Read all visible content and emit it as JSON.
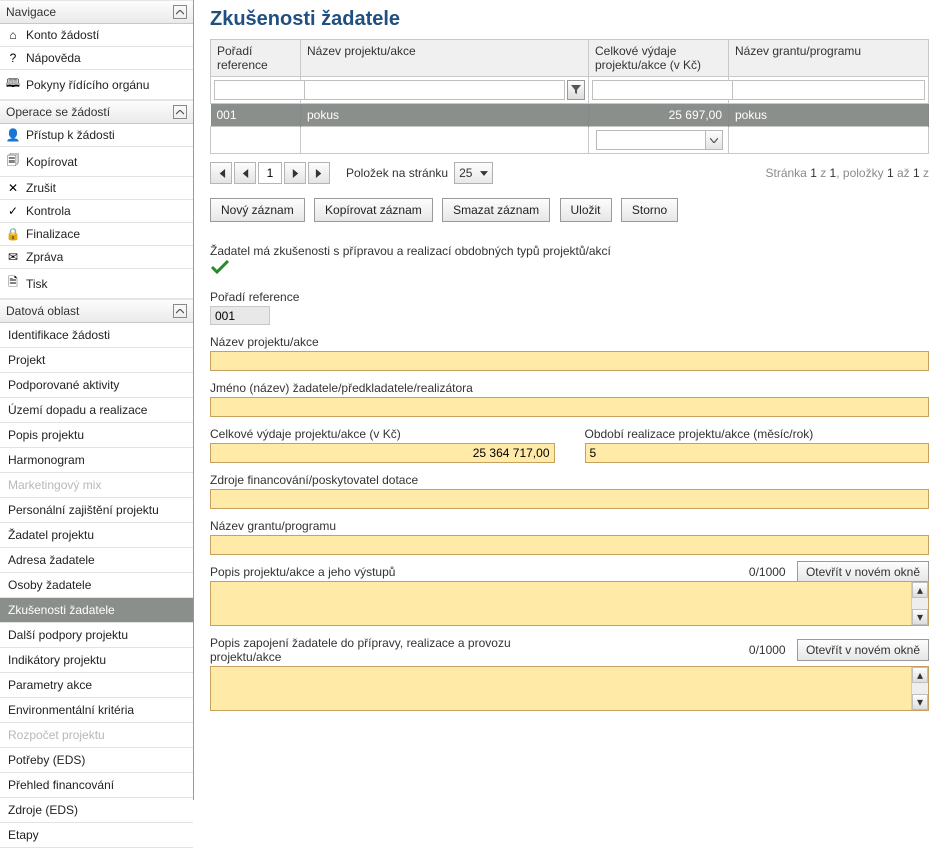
{
  "sidebar": {
    "nav_header": "Navigace",
    "nav_items": [
      {
        "icon": "⌂",
        "label": "Konto žádostí",
        "name": "nav-konto",
        "interactable": true
      },
      {
        "icon": "?",
        "label": "Nápověda",
        "name": "nav-help",
        "interactable": true
      },
      {
        "icon": "🕮",
        "label": "Pokyny řídícího orgánu",
        "name": "nav-pokyny",
        "interactable": true
      }
    ],
    "ops_header": "Operace se žádostí",
    "ops_items": [
      {
        "icon": "👤",
        "label": "Přístup k žádosti",
        "name": "op-access"
      },
      {
        "icon": "🗐",
        "label": "Kopírovat",
        "name": "op-copy"
      },
      {
        "icon": "✕",
        "label": "Zrušit",
        "name": "op-cancel"
      },
      {
        "icon": "✓",
        "label": "Kontrola",
        "name": "op-check"
      },
      {
        "icon": "🔒",
        "label": "Finalizace",
        "name": "op-finalize"
      },
      {
        "icon": "✉",
        "label": "Zpráva",
        "name": "op-message"
      },
      {
        "icon": "🗎",
        "label": "Tisk",
        "name": "op-print"
      }
    ],
    "data_header": "Datová oblast",
    "data_items": [
      {
        "label": "Identifikace žádosti",
        "name": "data-ident",
        "state": ""
      },
      {
        "label": "Projekt",
        "name": "data-projekt",
        "state": ""
      },
      {
        "label": "Podporované aktivity",
        "name": "data-aktivity",
        "state": ""
      },
      {
        "label": "Území dopadu a realizace",
        "name": "data-uzemi",
        "state": ""
      },
      {
        "label": "Popis projektu",
        "name": "data-popis",
        "state": ""
      },
      {
        "label": "Harmonogram",
        "name": "data-harmon",
        "state": ""
      },
      {
        "label": "Marketingový mix",
        "name": "data-marketing",
        "state": "disabled"
      },
      {
        "label": "Personální zajištění projektu",
        "name": "data-personal",
        "state": ""
      },
      {
        "label": "Žadatel projektu",
        "name": "data-zadatel",
        "state": ""
      },
      {
        "label": "Adresa žadatele",
        "name": "data-adresa",
        "state": ""
      },
      {
        "label": "Osoby žadatele",
        "name": "data-osoby",
        "state": ""
      },
      {
        "label": "Zkušenosti žadatele",
        "name": "data-zkusenosti",
        "state": "active"
      },
      {
        "label": "Další podpory projektu",
        "name": "data-podpory",
        "state": ""
      },
      {
        "label": "Indikátory projektu",
        "name": "data-indik",
        "state": ""
      },
      {
        "label": "Parametry akce",
        "name": "data-param",
        "state": ""
      },
      {
        "label": "Environmentální kritéria",
        "name": "data-envir",
        "state": ""
      },
      {
        "label": "Rozpočet projektu",
        "name": "data-rozpocet",
        "state": "disabled"
      },
      {
        "label": "Potřeby (EDS)",
        "name": "data-potreby",
        "state": ""
      },
      {
        "label": "Přehled financování",
        "name": "data-financ",
        "state": ""
      },
      {
        "label": "Zdroje (EDS)",
        "name": "data-zdroje",
        "state": ""
      },
      {
        "label": "Etapy",
        "name": "data-etapy",
        "state": ""
      }
    ]
  },
  "page": {
    "title": "Zkušenosti žadatele"
  },
  "grid": {
    "headers": {
      "ref": "Pořadí reference",
      "name": "Název projektu/akce",
      "expenses": "Celkové výdaje projektu/akce (v Kč)",
      "grant": "Název grantu/programu"
    },
    "row": {
      "ref": "001",
      "name": "pokus",
      "expenses": "25 697,00",
      "grant": "pokus"
    }
  },
  "pager": {
    "page": "1",
    "per_page_label": "Položek na stránku",
    "per_page_value": "25",
    "summary_prefix": "Stránka ",
    "summary_page": "1",
    "summary_of": " z ",
    "summary_total": "1",
    "summary_items_prefix": ", položky ",
    "summary_item_from": "1",
    "summary_item_to_word": " až ",
    "summary_item_to": "1",
    "summary_item_tail": " z"
  },
  "buttons": {
    "new": "Nový záznam",
    "copy": "Kopírovat záznam",
    "delete": "Smazat záznam",
    "save": "Uložit",
    "storno": "Storno"
  },
  "form": {
    "exp_label": "Žadatel má zkušenosti s přípravou a realizací obdobných typů projektů/akcí",
    "ref_label": "Pořadí reference",
    "ref_value": "001",
    "name_label": "Název projektu/akce",
    "applicant_label": "Jméno (název) žadatele/předkladatele/realizátora",
    "expenses_label": "Celkové výdaje projektu/akce (v Kč)",
    "expenses_value": "25 364 717,00",
    "period_label": "Období realizace projektu/akce (měsíc/rok)",
    "period_value": "5",
    "sources_label": "Zdroje financování/poskytovatel dotace",
    "grant_label": "Název grantu/programu",
    "desc1_label": "Popis projektu/akce a jeho výstupů",
    "desc2_label": "Popis zapojení žadatele do přípravy, realizace a provozu projektu/akce",
    "counter": "0/1000",
    "open_new": "Otevřít v novém okně"
  }
}
